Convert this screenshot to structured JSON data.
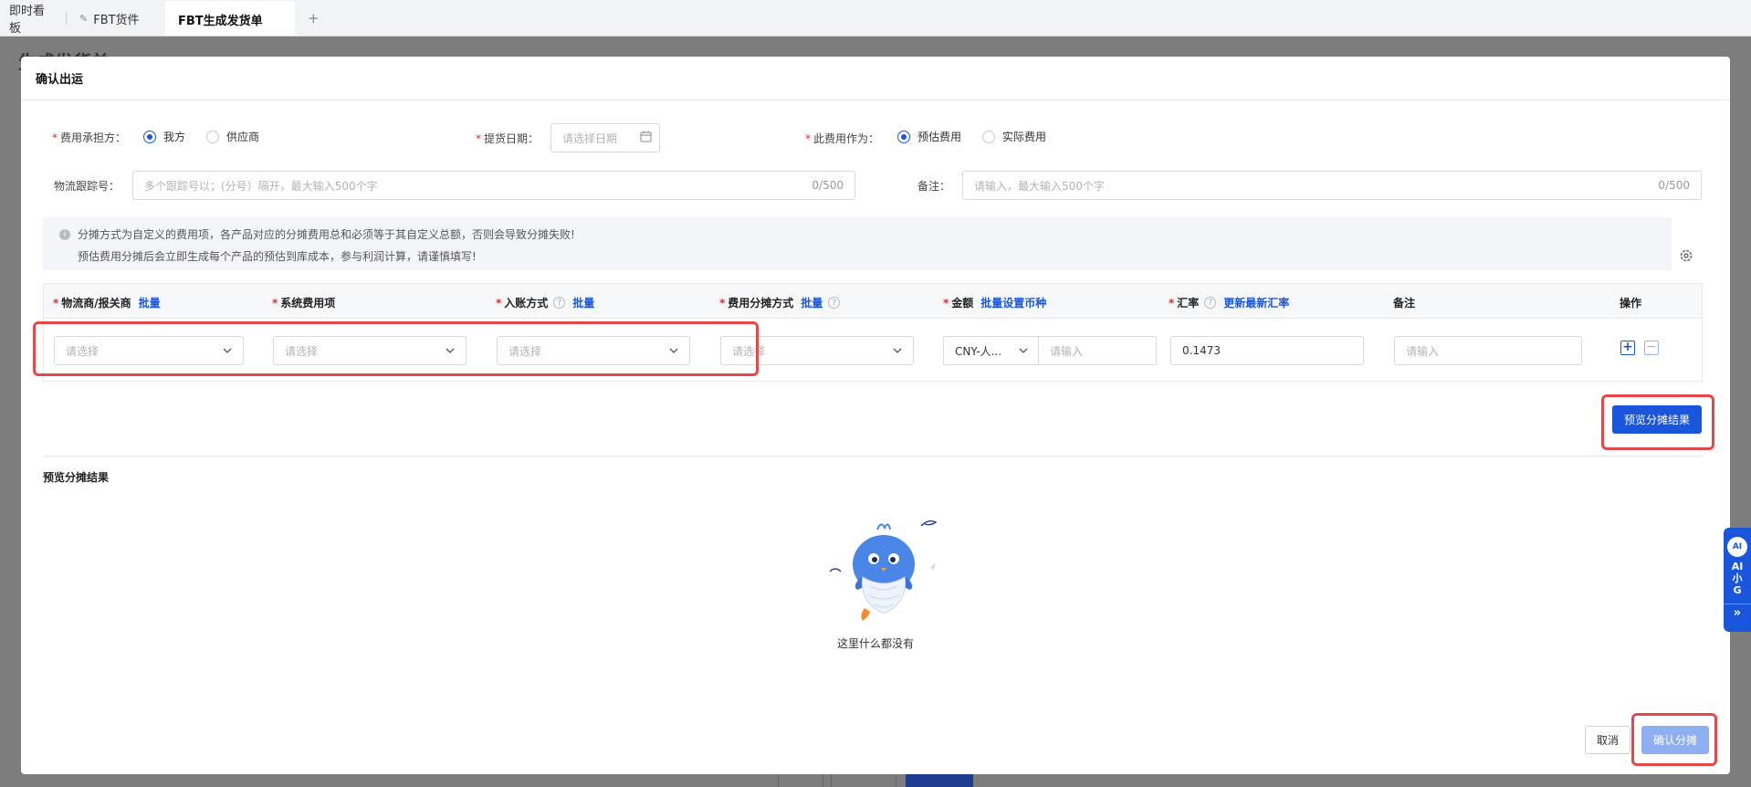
{
  "tabs": [
    {
      "label": "即时看板"
    },
    {
      "label": "FBT货件"
    },
    {
      "label": "FBT生成发货单"
    }
  ],
  "tab_add": "+",
  "bg_page_title": "生成发货单",
  "modal": {
    "title": "确认出运",
    "payer": {
      "label": "费用承担方：",
      "options": [
        "我方",
        "供应商"
      ],
      "selected": "我方"
    },
    "pickup_date": {
      "label": "提货日期：",
      "placeholder": "请选择日期"
    },
    "fee_type": {
      "label": "此费用作为：",
      "options": [
        "预估费用",
        "实际费用"
      ],
      "selected": "预估费用"
    },
    "tracking": {
      "label": "物流跟踪号：",
      "placeholder": "多个跟踪号以；(分号）隔开，最大输入500个字",
      "count": "0/500"
    },
    "remark": {
      "label": "备注：",
      "placeholder": "请输入，最大输入500个字",
      "count": "0/500"
    },
    "notice": {
      "line1": "分摊方式为自定义的费用项，各产品对应的分摊费用总和必须等于其自定义总额，否则会导致分摊失败!",
      "line2": "预估费用分摊后会立即生成每个产品的预估到库成本，参与利润计算，请谨慎填写!"
    },
    "table": {
      "headers": {
        "carrier": "物流商/报关商",
        "carrier_link": "批量",
        "sys_fee": "系统费用项",
        "account": "入账方式",
        "account_link": "批量",
        "alloc": "费用分摊方式",
        "alloc_link": "批量",
        "amount": "金额",
        "amount_link": "批量设置币种",
        "rate": "汇率",
        "rate_link": "更新最新汇率",
        "note": "备注",
        "ops": "操作"
      },
      "row": {
        "carrier_placeholder": "请选择",
        "sys_fee_placeholder": "请选择",
        "account_placeholder": "请选择",
        "alloc_placeholder": "请选择",
        "currency": "CNY-人...",
        "amount_placeholder": "请输入",
        "rate_value": "0.1473",
        "note_placeholder": "请输入"
      }
    },
    "preview_button": "预览分摊结果",
    "preview_section_title": "预览分摊结果",
    "empty_text": "这里什么都没有",
    "cancel_button": "取消",
    "confirm_button": "确认分摊"
  },
  "ai_widget": {
    "label": "AI小G",
    "icon_text": "AI",
    "expand": "»"
  },
  "colors": {
    "primary": "#1a56db",
    "highlight": "#e8474a",
    "required": "#e5282d"
  }
}
